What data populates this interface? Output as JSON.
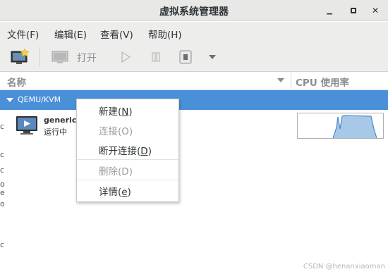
{
  "window": {
    "title": "虚拟系统管理器",
    "min_glyph": "▁",
    "max_glyph": "◻",
    "close_glyph": "✕"
  },
  "menubar": {
    "file": "文件(F)",
    "edit": "编辑(E)",
    "view": "查看(V)",
    "help": "帮助(H)"
  },
  "toolbar": {
    "new_vm_icon": "new-vm-icon",
    "open_label": "打开",
    "run_icon": "play-icon",
    "pause_icon": "pause-icon",
    "stop_icon": "stop-icon",
    "menu_arrow_icon": "chevron-down-icon"
  },
  "columns": {
    "name": "名称",
    "cpu": "CPU 使用率"
  },
  "connection": {
    "label": "QEMU/KVM"
  },
  "vm": {
    "name": "generic",
    "state": "运行中"
  },
  "context_menu": {
    "items": [
      {
        "prefix": "新建(",
        "mnemonic": "N",
        "suffix": ")",
        "enabled": true
      },
      {
        "prefix": "连接(",
        "mnemonic": "O",
        "suffix": ")",
        "enabled": false
      },
      {
        "prefix": "断开连接(",
        "mnemonic": "D",
        "suffix": ")",
        "enabled": true
      },
      {
        "prefix": "删除(",
        "mnemonic": "D",
        "suffix": ")",
        "enabled": false
      },
      {
        "prefix": "详情(",
        "mnemonic": "e",
        "suffix": ")",
        "enabled": true
      }
    ]
  },
  "left_edge_chars": [
    "c",
    "c",
    "c",
    "o",
    "e",
    "o",
    "c"
  ],
  "watermark": "CSDN @henanxiaoman",
  "colors": {
    "selection": "#4a90d9",
    "graph_fill": "#a8c8e8",
    "graph_line": "#4a8bc8"
  }
}
